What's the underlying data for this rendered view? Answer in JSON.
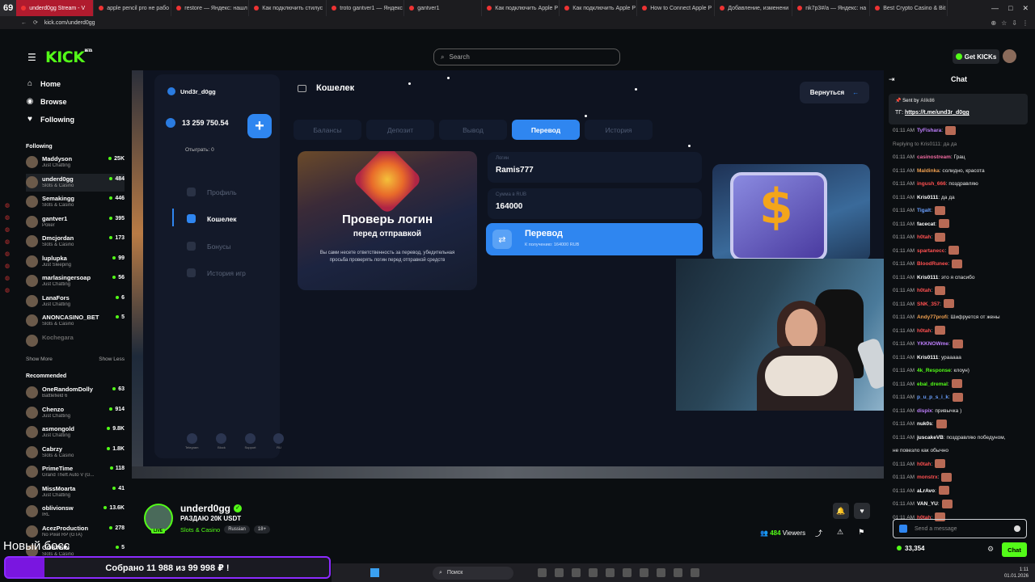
{
  "browser": {
    "tab_badge": "69",
    "tabs": [
      {
        "title": "underd0gg Stream - V",
        "active": true
      },
      {
        "title": "apple pencil pro не рабо",
        "active": false
      },
      {
        "title": "restore — Яндекс: нашл",
        "active": false
      },
      {
        "title": "Как подключить стилус",
        "active": false
      },
      {
        "title": "troto gantver1 — Яндекс",
        "active": false
      },
      {
        "title": "gantver1",
        "active": false
      },
      {
        "title": "Как подключить Apple P",
        "active": false
      },
      {
        "title": "Как подключить Apple P",
        "active": false
      },
      {
        "title": "How to Connect Apple P",
        "active": false
      },
      {
        "title": "Добавление, изменени",
        "active": false
      },
      {
        "title": "nk7p3#/a — Яндекс: на",
        "active": false
      },
      {
        "title": "Best Crypto Casino & Bit",
        "active": false
      }
    ],
    "url": "kick.com/underd0gg",
    "window_controls": [
      "—",
      "□",
      "✕"
    ]
  },
  "header": {
    "logo": "KICK",
    "logo_sup": "BETA",
    "search_placeholder": "Search",
    "get_kicks": "Get KICKs"
  },
  "sidebar": {
    "nav": [
      {
        "label": "Home",
        "icon": "home-icon"
      },
      {
        "label": "Browse",
        "icon": "compass-icon"
      },
      {
        "label": "Following",
        "icon": "heart-icon"
      }
    ],
    "following_title": "Following",
    "following": [
      {
        "name": "Maddyson",
        "category": "Just Chatting",
        "viewers": "25K"
      },
      {
        "name": "underd0gg",
        "category": "Slots & Casino",
        "viewers": "484",
        "active": true
      },
      {
        "name": "Semakingg",
        "category": "Slots & Casino",
        "viewers": "446"
      },
      {
        "name": "gantver1",
        "category": "Poker",
        "viewers": "395"
      },
      {
        "name": "Dmcjordan",
        "category": "Slots & Casino",
        "viewers": "173"
      },
      {
        "name": "luplupka",
        "category": "Just Sleeping",
        "viewers": "99"
      },
      {
        "name": "marlasingersoap",
        "category": "Just Chatting",
        "viewers": "56"
      },
      {
        "name": "LanaFors",
        "category": "Just Chatting",
        "viewers": "6"
      },
      {
        "name": "ANONCASINO_BET",
        "category": "Slots & Casino",
        "viewers": "5"
      },
      {
        "name": "Kochegara",
        "category": "",
        "viewers": "",
        "dim": true
      }
    ],
    "show_more": "Show More",
    "show_less": "Show Less",
    "recommended_title": "Recommended",
    "recommended": [
      {
        "name": "OneRandomDolly",
        "category": "Battlefield 6",
        "viewers": "63"
      },
      {
        "name": "Chenzo",
        "category": "Just Chatting",
        "viewers": "914"
      },
      {
        "name": "asmongold",
        "category": "Just Chatting",
        "viewers": "9.8K"
      },
      {
        "name": "Cabrzy",
        "category": "Slots & Casino",
        "viewers": "1.8K"
      },
      {
        "name": "PrimeTime",
        "category": "Grand Theft Auto V (G...",
        "viewers": "118"
      },
      {
        "name": "MissMoarta",
        "category": "Just Chatting",
        "viewers": "41"
      },
      {
        "name": "oblivionsw",
        "category": "IRL",
        "viewers": "13.6K"
      },
      {
        "name": "AcezProduction",
        "category": "No Pixel RP (GTA)",
        "viewers": "278"
      },
      {
        "name": "GOSTEIN",
        "category": "Slots & Casino",
        "viewers": "5"
      }
    ]
  },
  "stream_ui": {
    "username": "Und3r_d0gg",
    "balance": "13 259 750.54",
    "wagered_label": "Отыграть:",
    "wagered_value": "0",
    "menu": [
      {
        "label": "Профиль",
        "active": false
      },
      {
        "label": "Кошелек",
        "active": true
      },
      {
        "label": "Бонусы",
        "active": false
      },
      {
        "label": "История игр",
        "active": false
      }
    ],
    "footer": [
      "Telegram",
      "Block",
      "Support",
      "RU"
    ],
    "wallet_title": "Кошелек",
    "back_button": "Вернуться",
    "tabs": [
      {
        "label": "Балансы",
        "active": false
      },
      {
        "label": "Депозит",
        "active": false
      },
      {
        "label": "Вывод",
        "active": false
      },
      {
        "label": "Перевод",
        "active": true
      },
      {
        "label": "История",
        "active": false
      }
    ],
    "promo_title": "Проверь логин",
    "promo_sub": "перед отправкой",
    "promo_desc": "Вы сами несете ответственность за перевод, убедительная просьба проверять логин перед отправкой средств",
    "login_label": "Логин",
    "login_value": "Ramis777",
    "amount_label": "Сумма в RUB",
    "amount_value": "164000",
    "send_button": "Перевод",
    "send_sub": "К получению: 164000 RUB"
  },
  "stream_info": {
    "streamer": "underd0gg",
    "live_label": "LIVE",
    "title": "РАЗДАЮ 20К USDT",
    "category": "Slots & Casino",
    "tags": [
      "Russian",
      "18+"
    ],
    "viewers": "484",
    "viewers_label": "Viewers"
  },
  "chat": {
    "title": "Chat",
    "pinned_by_label": "Sent by",
    "pinned_by": "Alik86",
    "pinned_prefix": "ТГ:",
    "pinned_link": "https://t.me/und3r_d0gg",
    "messages": [
      {
        "time": "01:11 AM",
        "user": "TyFishara",
        "text": "",
        "color": "#c080ff",
        "emote": true
      },
      {
        "time": "",
        "user": "",
        "text": "Replying to Kris0111: да да",
        "color": "#888",
        "emote": false,
        "reply": true
      },
      {
        "time": "01:11 AM",
        "user": "casinostream",
        "text": "Грац",
        "color": "#f06aa0",
        "emote": false
      },
      {
        "time": "01:11 AM",
        "user": "Maldinka",
        "text": "солидно, красота",
        "color": "#f0a050",
        "emote": false
      },
      {
        "time": "01:11 AM",
        "user": "ingush_666",
        "text": "поздравляю",
        "color": "#ff5050",
        "emote": false
      },
      {
        "time": "01:11 AM",
        "user": "Kris0111",
        "text": "да да",
        "color": "#ffffff",
        "emote": false
      },
      {
        "time": "01:11 AM",
        "user": "Tigalt",
        "text": "",
        "color": "#6aa0ff",
        "emote": true
      },
      {
        "time": "01:11 AM",
        "user": "facecat",
        "text": "",
        "color": "#ffffff",
        "emote": true
      },
      {
        "time": "01:11 AM",
        "user": "h0tah",
        "text": "",
        "color": "#ff5050",
        "emote": true
      },
      {
        "time": "01:11 AM",
        "user": "spartanecc",
        "text": "",
        "color": "#ff5050",
        "emote": true
      },
      {
        "time": "01:11 AM",
        "user": "BloodRunee",
        "text": "",
        "color": "#ff5050",
        "emote": true
      },
      {
        "time": "01:11 AM",
        "user": "Kris0111",
        "text": "это я спасибо",
        "color": "#ffffff",
        "emote": false
      },
      {
        "time": "01:11 AM",
        "user": "h0tah",
        "text": "",
        "color": "#ff5050",
        "emote": true
      },
      {
        "time": "01:11 AM",
        "user": "SNK_357",
        "text": "",
        "color": "#ff5050",
        "emote": true
      },
      {
        "time": "01:11 AM",
        "user": "Andy77profi",
        "text": "Шифруется от жены",
        "color": "#f0a050",
        "emote": false
      },
      {
        "time": "01:11 AM",
        "user": "h0tah",
        "text": "",
        "color": "#ff5050",
        "emote": true
      },
      {
        "time": "01:11 AM",
        "user": "YKKNOWme",
        "text": "",
        "color": "#c080ff",
        "emote": true
      },
      {
        "time": "01:11 AM",
        "user": "Kris0111",
        "text": "урааааа",
        "color": "#ffffff",
        "emote": false
      },
      {
        "time": "01:11 AM",
        "user": "4k_Response",
        "text": "клоун)",
        "color": "#53fc18",
        "emote": false
      },
      {
        "time": "01:11 AM",
        "user": "ebal_dremal",
        "text": "",
        "color": "#53fc18",
        "emote": true
      },
      {
        "time": "01:11 AM",
        "user": "p_u_p_s_i_k",
        "text": "",
        "color": "#6aa0ff",
        "emote": true
      },
      {
        "time": "01:11 AM",
        "user": "dispix",
        "text": "привычка )",
        "color": "#c080ff",
        "emote": false
      },
      {
        "time": "01:11 AM",
        "user": "nuk0s",
        "text": "",
        "color": "#ffffff",
        "emote": true
      },
      {
        "time": "01:11 AM",
        "user": "juscakeVB",
        "text": "поздравляю победуном,",
        "color": "#ffffff",
        "emote": false
      },
      {
        "time": "",
        "user": "",
        "text": "не повезло как обычно",
        "color": "#e8e8e8",
        "emote": false
      },
      {
        "time": "01:11 AM",
        "user": "h0tah",
        "text": "",
        "color": "#ff5050",
        "emote": true
      },
      {
        "time": "01:11 AM",
        "user": "monstrx",
        "text": "",
        "color": "#ff5050",
        "emote": true
      },
      {
        "time": "01:11 AM",
        "user": "aLrAvo",
        "text": "",
        "color": "#ffffff",
        "emote": true
      },
      {
        "time": "01:11 AM",
        "user": "VAN_YU",
        "text": "",
        "color": "#ffffff",
        "emote": true
      },
      {
        "time": "01:11 AM",
        "user": "h0tah",
        "text": "",
        "color": "#ff5050",
        "emote": true
      }
    ],
    "input_placeholder": "Send a message",
    "kicks_count": "33,354",
    "chat_button": "Chat"
  },
  "overlay": {
    "corner_text": "Новый босс",
    "donation": "Собрано 11 988  из 99 998 ₽ !"
  },
  "taskbar": {
    "search": "Поиск",
    "time": "1:11",
    "date": "01.01.2026"
  }
}
